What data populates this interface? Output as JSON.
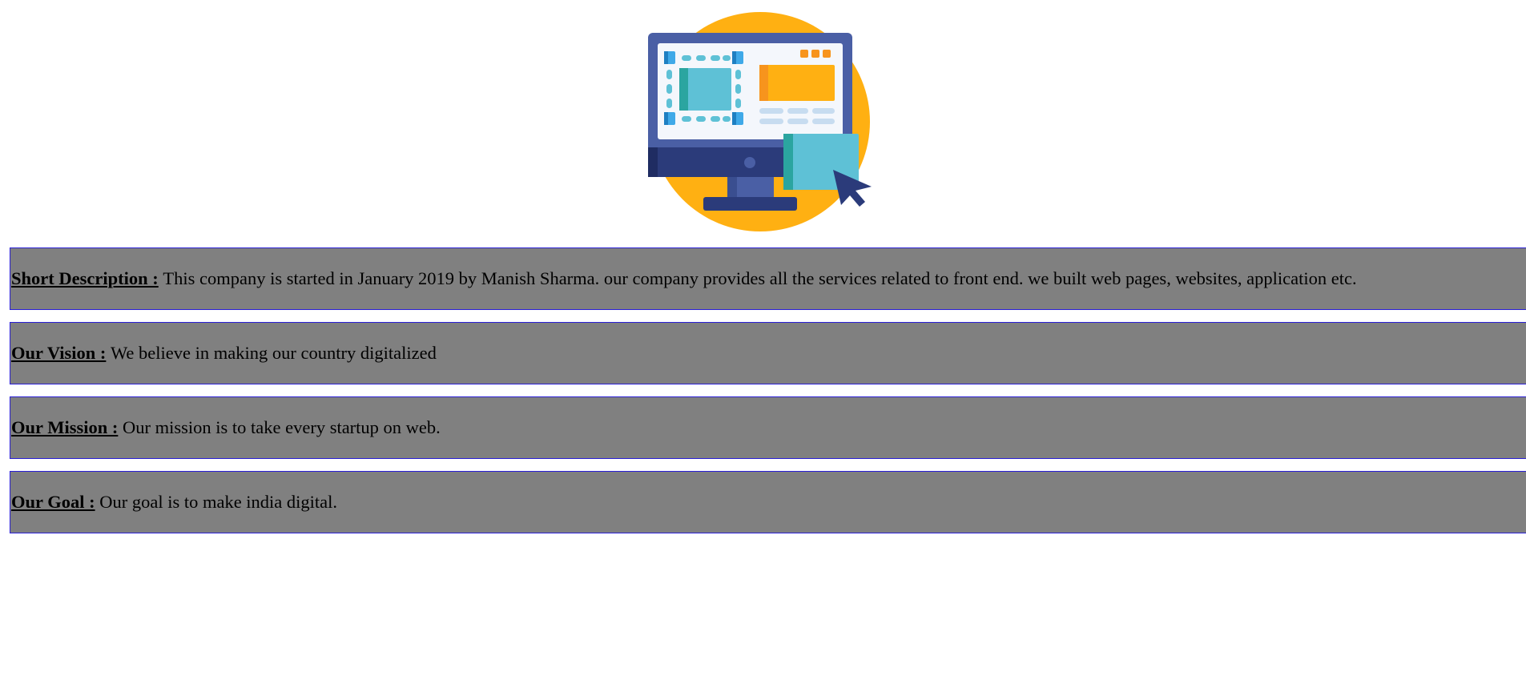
{
  "hero": {
    "illustration_icon": "computer-monitor-web-design-icon",
    "colors": {
      "circle": "#FFB012",
      "monitor_frame": "#4A5FA5",
      "monitor_base": "#2B3B7A",
      "screen": "#F4F7FC",
      "accent_cyan": "#5EC1D6",
      "accent_teal": "#2BA5A0",
      "accent_blue": "#3FA9E8",
      "accent_orange": "#F7941D",
      "accent_yellow": "#FFB012"
    }
  },
  "sections": [
    {
      "id": "short-description",
      "label": "Short Description : ",
      "text": "This company is started in January 2019 by Manish Sharma. our company provides all the services related to front end. we built web pages, websites, application etc."
    },
    {
      "id": "vision",
      "label": "Our Vision :",
      "text": "We believe in making our country digitalized"
    },
    {
      "id": "mission",
      "label": "Our Mission :",
      "text": "Our mission is to take every startup on web."
    },
    {
      "id": "goal",
      "label": "Our Goal :",
      "text": "Our goal is to make india digital."
    }
  ],
  "style": {
    "box_background": "#808080",
    "box_border": "#2A1FD6"
  }
}
